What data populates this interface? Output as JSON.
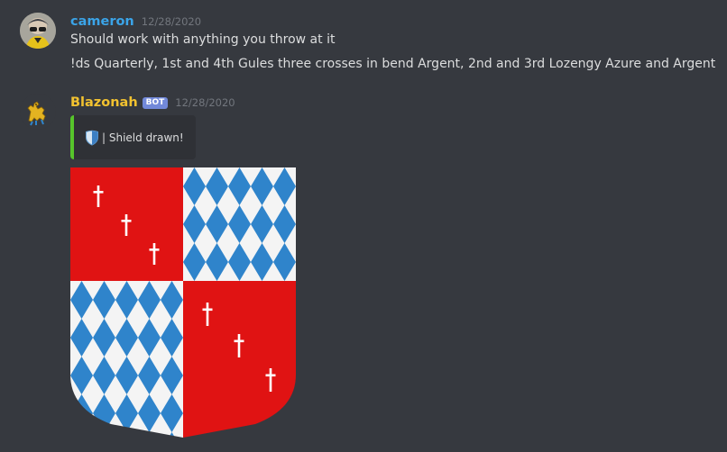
{
  "messages": [
    {
      "username": "cameron",
      "timestamp": "12/28/2020",
      "lines": [
        "Should work with anything you throw at it",
        "!ds Quarterly, 1st and 4th Gules three crosses in bend Argent, 2nd and 3rd Lozengy Azure and Argent"
      ],
      "username_color": "#3ba4e8",
      "avatar_icon": "user-avatar-photo"
    },
    {
      "username": "Blazonah",
      "bot_tag": "BOT",
      "timestamp": "12/28/2020",
      "embed": {
        "icon": "shield-icon",
        "text": "| Shield drawn!",
        "accent_color": "#57c52b"
      },
      "image": {
        "kind": "shield-drawing",
        "colors": {
          "gules": "#e01313",
          "azure": "#2f84cb",
          "argent": "#f4f4f4"
        }
      },
      "username_color": "#f2c230",
      "avatar_icon": "lion-rampant-icon"
    }
  ],
  "theme": {
    "background": "#36393f",
    "text": "#dcddde",
    "muted": "#72767d"
  }
}
